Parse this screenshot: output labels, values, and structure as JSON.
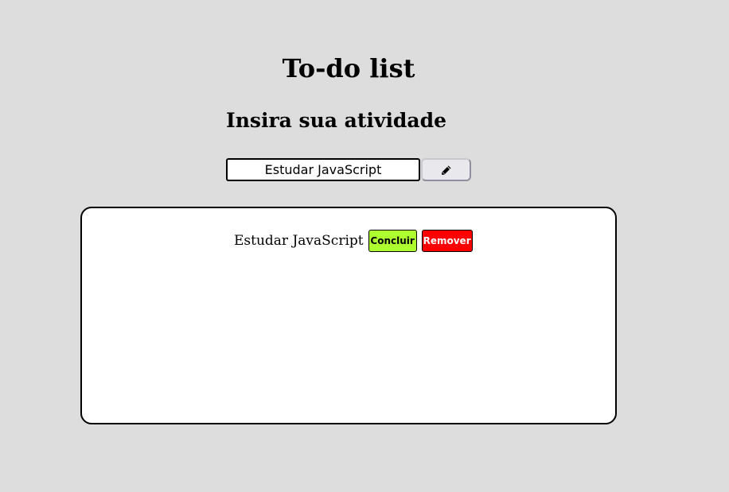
{
  "header": {
    "title": "To-do list",
    "subtitle": "Insira sua atividade"
  },
  "form": {
    "input_value": "Estudar JavaScript",
    "add_button_icon": "pencil-icon"
  },
  "tasks": [
    {
      "text": "Estudar JavaScript",
      "conclude_label": "Concluir",
      "remove_label": "Remover"
    }
  ],
  "colors": {
    "background": "#dddddd",
    "conclude_button": "#adff2f",
    "remove_button": "#ff0000"
  }
}
